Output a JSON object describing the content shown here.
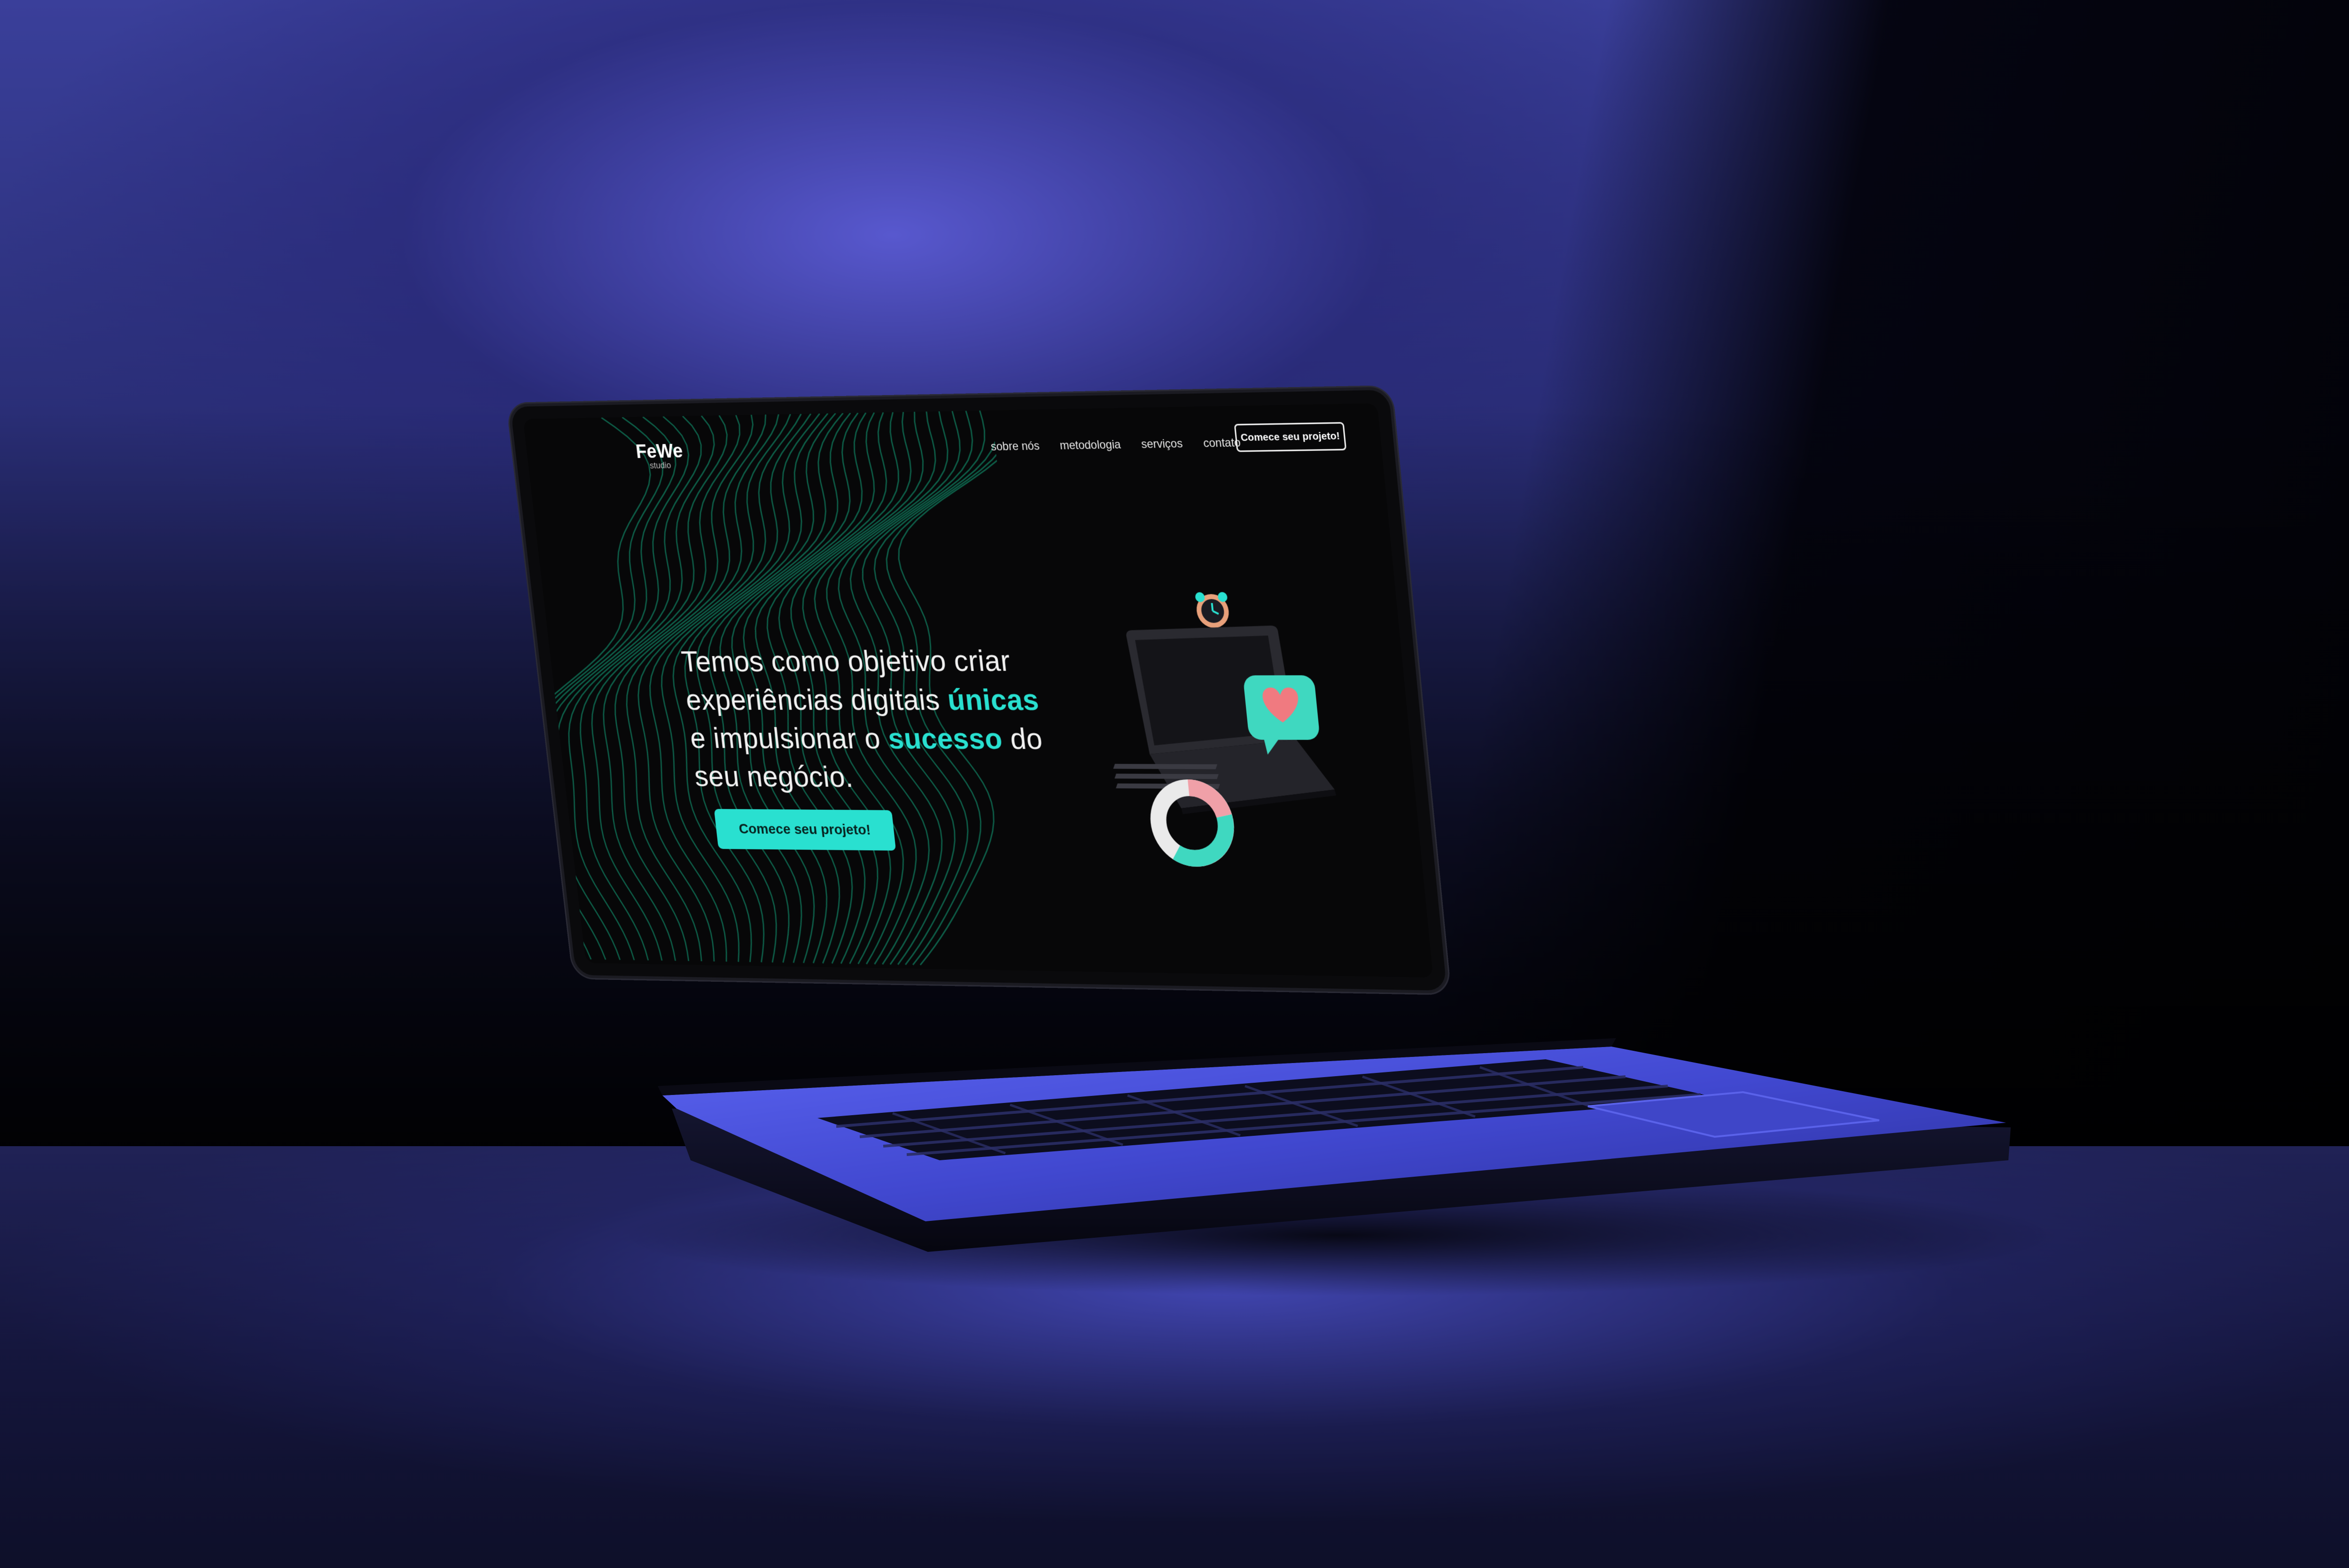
{
  "nav": {
    "logo_name": "FeWe",
    "logo_sub": "studio",
    "links": [
      "sobre nós",
      "metodologia",
      "serviços",
      "contato"
    ],
    "cta_label": "Comece seu projeto!"
  },
  "hero": {
    "line1": "Temos como objetivo criar",
    "line2_pre": "experiências digitais ",
    "line2_hl": "únicas",
    "line3_pre": "e impulsionar o ",
    "line3_hl": "sucesso",
    "line3_post": " do",
    "line4": "seu negócio.",
    "cta_label": "Comece seu projeto!"
  },
  "colors": {
    "accent": "#29e0d0",
    "screen_bg": "#070708",
    "wave_stroke": "#0f6b52",
    "laptop_blue": "#4a52e0"
  },
  "icons": {
    "illustration": "laptop-illustration-icon",
    "clock": "alarm-clock-icon",
    "heart": "heart-speech-bubble-icon",
    "donut": "donut-chart-icon"
  }
}
